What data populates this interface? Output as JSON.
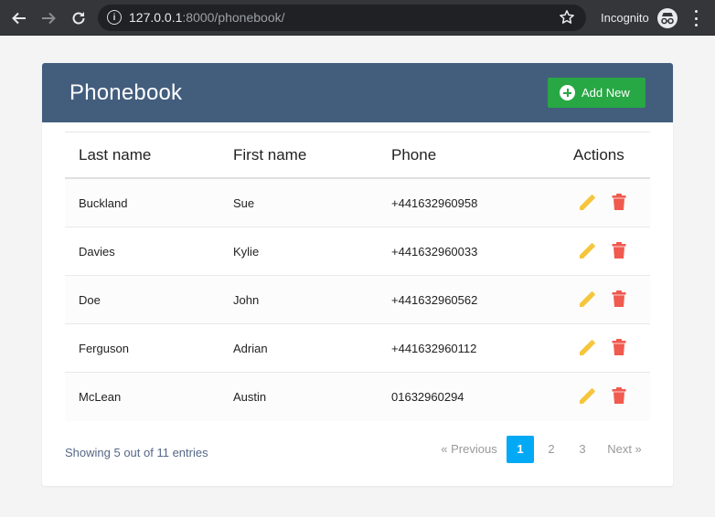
{
  "browser": {
    "url_host": "127.0.0.1",
    "url_rest": ":8000/phonebook/",
    "incognito_label": "Incognito"
  },
  "header": {
    "title": "Phonebook",
    "add_label": "Add New"
  },
  "table": {
    "columns": [
      "Last name",
      "First name",
      "Phone",
      "Actions"
    ],
    "rows": [
      {
        "last": "Buckland",
        "first": "Sue",
        "phone": "+441632960958"
      },
      {
        "last": "Davies",
        "first": "Kylie",
        "phone": "+441632960033"
      },
      {
        "last": "Doe",
        "first": "John",
        "phone": "+441632960562"
      },
      {
        "last": "Ferguson",
        "first": "Adrian",
        "phone": "+441632960112"
      },
      {
        "last": "McLean",
        "first": "Austin",
        "phone": "01632960294"
      }
    ]
  },
  "footer": {
    "hint": "Showing 5 out of 11 entries",
    "pagination": {
      "previous": "« Previous",
      "pages": [
        "1",
        "2",
        "3"
      ],
      "current": "1",
      "next": "Next »"
    }
  },
  "colors": {
    "header_bg": "#435d7d",
    "add_button": "#28a745",
    "edit_icon": "#f5c63c",
    "delete_icon": "#f05a4f",
    "active_page": "#03a9f4"
  }
}
